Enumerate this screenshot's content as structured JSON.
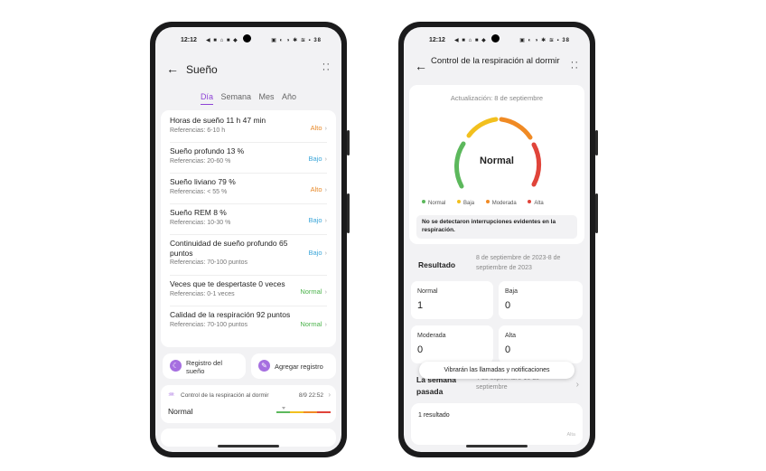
{
  "status_bar": {
    "time": "12:12",
    "left_icons": "◀ ■ ⌂ ■ ◆",
    "right_icons": "▣ ◐ ◑ ✱ ≋ ▪ 38"
  },
  "screen1": {
    "title": "Sueño",
    "tabs": [
      {
        "label": "Día",
        "active": true
      },
      {
        "label": "Semana"
      },
      {
        "label": "Mes"
      },
      {
        "label": "Año"
      }
    ],
    "metrics": [
      {
        "name": "Horas de sueño  11 h 47 min",
        "ref": "Referencias: 6-10  h",
        "status": "Alto",
        "level": "alto"
      },
      {
        "name": "Sueño profundo  13 %",
        "ref": "Referencias: 20-60 %",
        "status": "Bajo",
        "level": "bajo"
      },
      {
        "name": "Sueño liviano  79 %",
        "ref": "Referencias: < 55 %",
        "status": "Alto",
        "level": "alto"
      },
      {
        "name": "Sueño REM  8 %",
        "ref": "Referencias: 10-30 %",
        "status": "Bajo",
        "level": "bajo"
      },
      {
        "name": "Continuidad de sueño profundo  65 puntos",
        "ref": "Referencias: 70-100 puntos",
        "status": "Bajo",
        "level": "bajo"
      },
      {
        "name": "Veces que te despertaste  0 veces",
        "ref": "Referencias: 0-1 veces",
        "status": "Normal",
        "level": "normal"
      },
      {
        "name": "Calidad de la respiración  92 puntos",
        "ref": "Referencias: 70-100 puntos",
        "status": "Normal",
        "level": "normal"
      }
    ],
    "buttons": {
      "record": "Registro del sueño",
      "add": "Agregar registro"
    },
    "breathing_card": {
      "title": "Control de la respiración al dormir",
      "datetime": "8/9 22:52",
      "value": "Normal"
    }
  },
  "screen2": {
    "title": "Control de la respiración al dormir",
    "updated": "Actualización: 8 de septiembre",
    "gauge_value": "Normal",
    "legend": [
      {
        "label": "Normal",
        "color": "#5cb85c"
      },
      {
        "label": "Baja",
        "color": "#f2c01e"
      },
      {
        "label": "Moderada",
        "color": "#f08a24"
      },
      {
        "label": "Alta",
        "color": "#e0443a"
      }
    ],
    "notice": "No se detectaron interrupciones evidentes en la respiración.",
    "result": {
      "label": "Resultado",
      "range": "8 de septiembre de 2023-8 de septiembre de 2023"
    },
    "counts": [
      {
        "label": "Normal",
        "value": "1"
      },
      {
        "label": "Baja",
        "value": "0"
      },
      {
        "label": "Moderada",
        "value": "0"
      },
      {
        "label": "Alta",
        "value": "0"
      }
    ],
    "toast": "Vibrarán las llamadas y notificaciones",
    "last_week": {
      "label": "La semana pasada",
      "range": "4 de septiembre-10 de septiembre"
    },
    "results_count": "1 resultado",
    "axis_label": "Alta"
  }
}
